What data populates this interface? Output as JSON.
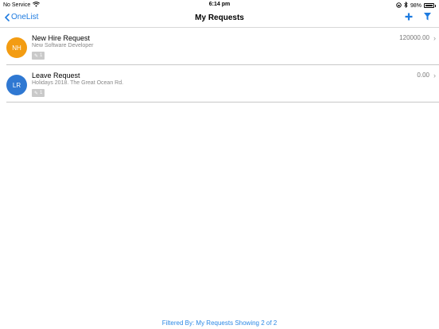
{
  "status_bar": {
    "carrier": "No Service",
    "time": "6:14 pm",
    "battery": "98%",
    "battery_level": 0.98
  },
  "nav": {
    "back_label": "OneList",
    "title": "My Requests",
    "accent_color": "#1e7be0",
    "icons": [
      "plus-icon",
      "filter-icon"
    ]
  },
  "requests": [
    {
      "initials": "NH",
      "avatar_color": "#f39c12",
      "title": "New Hire Request",
      "subtitle": "New Software Developer",
      "amount": "120000.00",
      "attachment_count": "1"
    },
    {
      "initials": "LR",
      "avatar_color": "#2f78d2",
      "title": "Leave Request",
      "subtitle": "Holidays 2018. The Great Ocean Rd.",
      "amount": "0.00",
      "attachment_count": "1"
    }
  ],
  "footer": {
    "text": "Filtered By: My Requests Showing 2 of 2"
  }
}
